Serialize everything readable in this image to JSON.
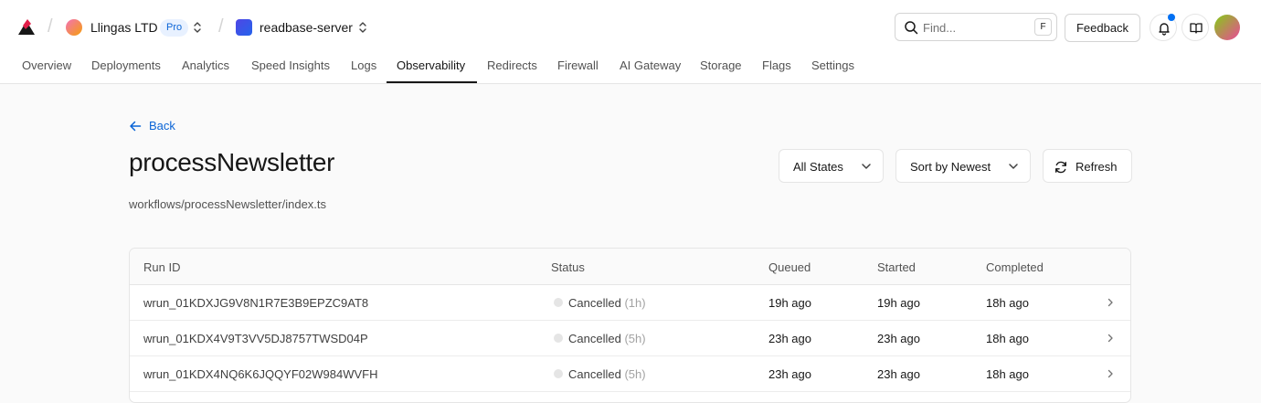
{
  "header": {
    "team_name": "Llingas LTD",
    "team_plan": "Pro",
    "project_name": "readbase-server",
    "search_placeholder": "Find...",
    "search_shortcut": "F",
    "feedback_label": "Feedback"
  },
  "tabs": [
    {
      "label": "Overview"
    },
    {
      "label": "Deployments"
    },
    {
      "label": "Analytics"
    },
    {
      "label": "Speed Insights"
    },
    {
      "label": "Logs"
    },
    {
      "label": "Observability",
      "active": true
    },
    {
      "label": "Redirects"
    },
    {
      "label": "Firewall"
    },
    {
      "label": "AI Gateway"
    },
    {
      "label": "Storage"
    },
    {
      "label": "Flags"
    },
    {
      "label": "Settings"
    }
  ],
  "page": {
    "back_label": "Back",
    "title": "processNewsletter",
    "path": "workflows/processNewsletter/index.ts",
    "filter_label": "All States",
    "sort_label": "Sort by Newest",
    "refresh_label": "Refresh"
  },
  "table": {
    "columns": [
      "Run ID",
      "Status",
      "Queued",
      "Started",
      "Completed"
    ],
    "rows": [
      {
        "id": "wrun_01KDXJG9V8N1R7E3B9EPZC9AT8",
        "status": "Cancelled",
        "duration": "(1h)",
        "queued": "19h ago",
        "started": "19h ago",
        "completed": "18h ago"
      },
      {
        "id": "wrun_01KDX4V9T3VV5DJ8757TWSD04P",
        "status": "Cancelled",
        "duration": "(5h)",
        "queued": "23h ago",
        "started": "23h ago",
        "completed": "18h ago"
      },
      {
        "id": "wrun_01KDX4NQ6K6JQQYF02W984WVFH",
        "status": "Cancelled",
        "duration": "(5h)",
        "queued": "23h ago",
        "started": "23h ago",
        "completed": "18h ago"
      }
    ]
  },
  "colors": {
    "accent": "#0a64d6",
    "notification": "#0070f3"
  }
}
